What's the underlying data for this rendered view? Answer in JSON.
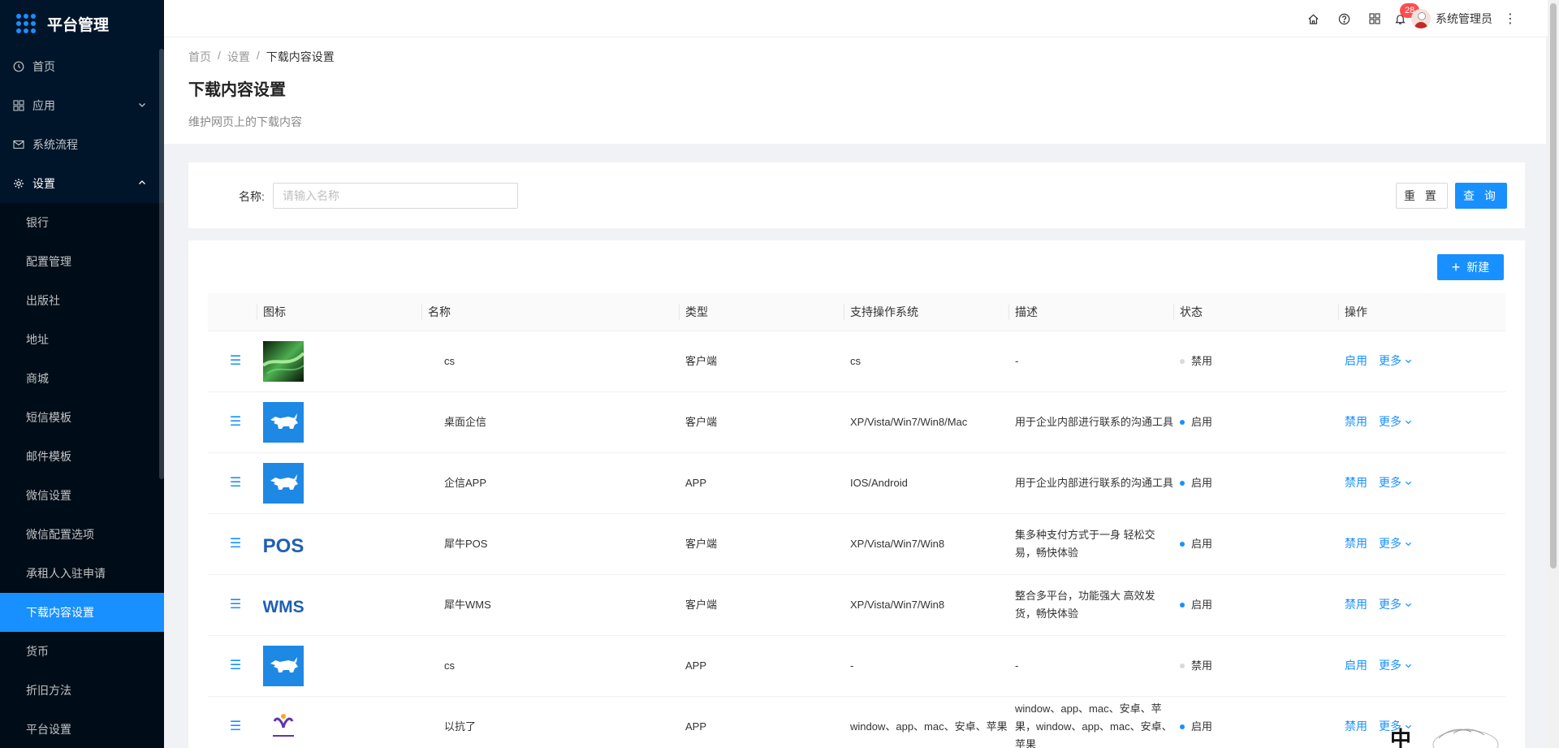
{
  "app": {
    "title": "平台管理"
  },
  "sidebar": {
    "top_items": [
      {
        "label": "首页",
        "icon": "clock-icon"
      },
      {
        "label": "应用",
        "icon": "appstore-icon",
        "expand": "chevron-down-icon"
      },
      {
        "label": "系统流程",
        "icon": "mail-icon"
      },
      {
        "label": "设置",
        "icon": "gear-icon",
        "expand": "chevron-up-icon"
      }
    ],
    "sub_items": [
      {
        "label": "银行"
      },
      {
        "label": "配置管理"
      },
      {
        "label": "出版社"
      },
      {
        "label": "地址"
      },
      {
        "label": "商城"
      },
      {
        "label": "短信模板"
      },
      {
        "label": "邮件模板"
      },
      {
        "label": "微信设置"
      },
      {
        "label": "微信配置选项"
      },
      {
        "label": "承租人入驻申请"
      },
      {
        "label": "下载内容设置"
      },
      {
        "label": "货币"
      },
      {
        "label": "折旧方法"
      },
      {
        "label": "平台设置"
      }
    ],
    "active_item": "下载内容设置"
  },
  "header": {
    "icons": [
      "home-icon",
      "question-icon",
      "appstore-icon",
      "bell-icon"
    ],
    "notification_count": "28",
    "username": "系统管理员"
  },
  "breadcrumb": {
    "items": [
      "首页",
      "设置",
      "下载内容设置"
    ],
    "separator": "/"
  },
  "page": {
    "title": "下载内容设置",
    "description": "维护网页上的下载内容"
  },
  "search": {
    "name_label": "名称:",
    "name_placeholder": "请输入名称",
    "name_value": "",
    "reset_label": "重 置",
    "query_label": "查 询"
  },
  "toolbar": {
    "new_label": "新建"
  },
  "table": {
    "columns": [
      "",
      "图标",
      "名称",
      "类型",
      "支持操作系统",
      "描述",
      "状态",
      "操作"
    ],
    "rows": [
      {
        "icon": "aurora-image",
        "name": "cs",
        "type": "客户端",
        "os": "cs",
        "desc": "-",
        "status": "禁用",
        "status_color": "#d9d9d9",
        "action": "启用",
        "more": "更多"
      },
      {
        "icon": "rhino-logo",
        "name": "桌面企信",
        "type": "客户端",
        "os": "XP/Vista/Win7/Win8/Mac",
        "desc": "用于企业内部进行联系的沟通工具",
        "status": "启用",
        "status_color": "#1890ff",
        "action": "禁用",
        "more": "更多"
      },
      {
        "icon": "rhino-logo",
        "name": "企信APP",
        "type": "APP",
        "os": "IOS/Android",
        "desc": "用于企业内部进行联系的沟通工具",
        "status": "启用",
        "status_color": "#1890ff",
        "action": "禁用",
        "more": "更多"
      },
      {
        "icon": "pos-logo",
        "name": "犀牛POS",
        "type": "客户端",
        "os": "XP/Vista/Win7/Win8",
        "desc": "集多种支付方式于一身 轻松交易，畅快体验",
        "status": "启用",
        "status_color": "#1890ff",
        "action": "禁用",
        "more": "更多"
      },
      {
        "icon": "wms-logo",
        "name": "犀牛WMS",
        "type": "客户端",
        "os": "XP/Vista/Win7/Win8",
        "desc": "整合多平台，功能强大 高效发货，畅快体验",
        "status": "启用",
        "status_color": "#1890ff",
        "action": "禁用",
        "more": "更多"
      },
      {
        "icon": "rhino-logo",
        "name": "cs",
        "type": "APP",
        "os": "-",
        "desc": "-",
        "status": "禁用",
        "status_color": "#d9d9d9",
        "action": "启用",
        "more": "更多"
      },
      {
        "icon": "yikangle-logo",
        "name": "以抗了",
        "type": "APP",
        "os": "window、app、mac、安卓、苹果",
        "desc": "window、app、mac、安卓、苹果，window、app、mac、安卓、苹果",
        "status": "启用",
        "status_color": "#1890ff",
        "action": "禁用",
        "more": "更多"
      }
    ]
  },
  "theme": {
    "primary": "#1890ff",
    "sidebar_bg": "#001529",
    "submenu_bg": "#000c17",
    "danger": "#ff4d4f"
  }
}
